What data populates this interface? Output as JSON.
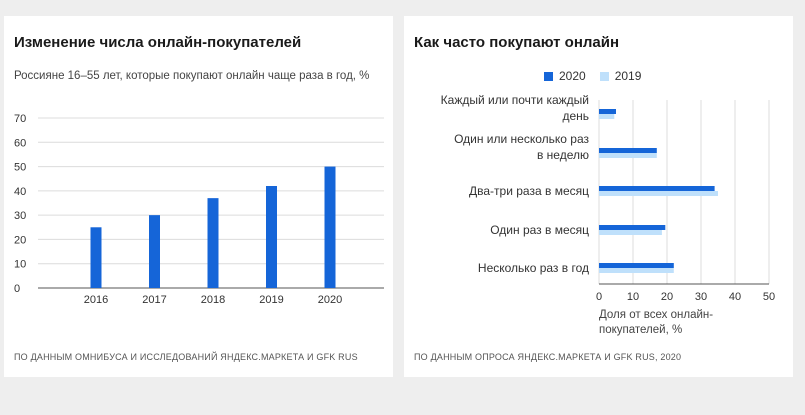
{
  "chart_data": [
    {
      "type": "bar",
      "title": "Изменение числа онлайн-покупателей",
      "subtitle": "Россияне 16–55 лет, которые покупают онлайн чаще раза в год, %",
      "categories": [
        "2016",
        "2017",
        "2018",
        "2019",
        "2020"
      ],
      "values": [
        25,
        30,
        37,
        42,
        50
      ],
      "yticks": [
        "0",
        "10",
        "20",
        "30",
        "40",
        "50",
        "60",
        "70"
      ],
      "ylim": [
        0,
        70
      ],
      "grid": true,
      "color": "#1565d8",
      "source": "ПО ДАННЫМ ОМНИБУСА И ИССЛЕДОВАНИЙ ЯНДЕКС.МАРКЕТА И GFK RUS"
    },
    {
      "type": "bar",
      "orientation": "horizontal",
      "title": "Как часто покупают онлайн",
      "categories": [
        [
          "Каждый или почти каждый",
          "день"
        ],
        [
          "Один или несколько раз",
          "в неделю"
        ],
        [
          "Два-три раза в месяц"
        ],
        [
          "Один раз в месяц"
        ],
        [
          "Несколько раз в год"
        ]
      ],
      "series": [
        {
          "name": "2020",
          "color": "#1565d8",
          "values": [
            5,
            17,
            34,
            19.5,
            22
          ]
        },
        {
          "name": "2019",
          "color": "#bfe0fb",
          "values": [
            4.5,
            17,
            35,
            18.5,
            22
          ]
        }
      ],
      "xticks": [
        "0",
        "10",
        "20",
        "30",
        "40",
        "50"
      ],
      "xlim": [
        0,
        50
      ],
      "xlabel": [
        "Доля от всех онлайн-",
        "покупателей, %"
      ],
      "legend": "top",
      "grid": true,
      "source": "ПО ДАННЫМ ОПРОСА ЯНДЕКС.МАРКЕТА И GFK RUS, 2020"
    }
  ]
}
